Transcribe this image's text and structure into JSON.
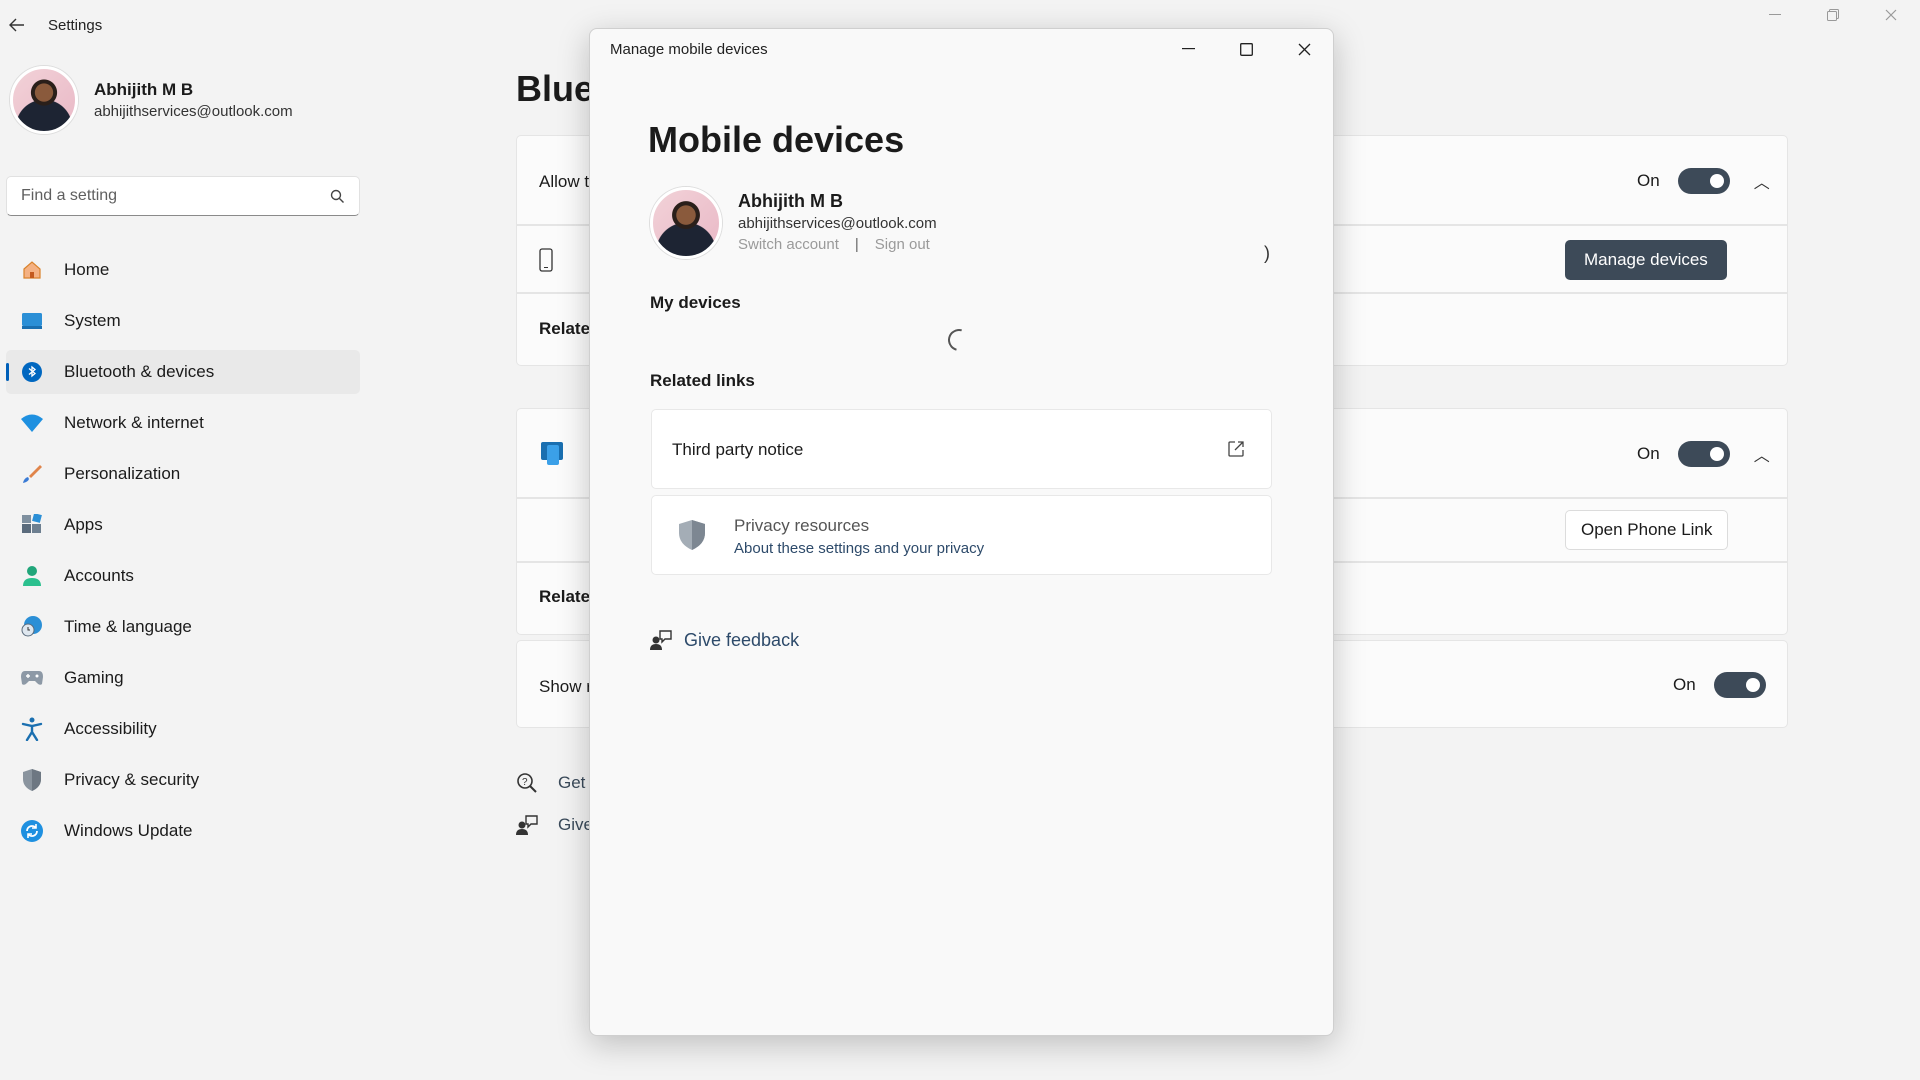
{
  "app": {
    "title": "Settings",
    "back_label": "←"
  },
  "profile": {
    "name": "Abhijith M B",
    "email": "abhijithservices@outlook.com"
  },
  "search": {
    "placeholder": "Find a setting"
  },
  "nav": {
    "items": [
      {
        "label": "Home",
        "icon": "home-icon"
      },
      {
        "label": "System",
        "icon": "system-icon"
      },
      {
        "label": "Bluetooth & devices",
        "icon": "bluetooth-icon",
        "active": true
      },
      {
        "label": "Network & internet",
        "icon": "wifi-icon"
      },
      {
        "label": "Personalization",
        "icon": "brush-icon"
      },
      {
        "label": "Apps",
        "icon": "apps-icon"
      },
      {
        "label": "Accounts",
        "icon": "accounts-icon"
      },
      {
        "label": "Time & language",
        "icon": "globe-clock-icon"
      },
      {
        "label": "Gaming",
        "icon": "gamepad-icon"
      },
      {
        "label": "Accessibility",
        "icon": "accessibility-icon"
      },
      {
        "label": "Privacy & security",
        "icon": "shield-icon"
      },
      {
        "label": "Windows Update",
        "icon": "update-icon"
      }
    ]
  },
  "content": {
    "title_fragment": "Blue",
    "card1": {
      "text": "Allow t",
      "toggle_label": "On",
      "toggle_on": true
    },
    "card2": {
      "button": "Manage devices"
    },
    "card3": {
      "text": "Relate"
    },
    "card4": {
      "toggle_label": "On",
      "toggle_on": true
    },
    "card5": {
      "button": "Open Phone Link"
    },
    "card6": {
      "text": "Relate"
    },
    "card7": {
      "text": "Show r",
      "toggle_label": "On",
      "toggle_on": true
    },
    "links": [
      {
        "label": "Get",
        "icon": "get-help-icon"
      },
      {
        "label": "Give",
        "icon": "feedback-icon"
      }
    ]
  },
  "dialog": {
    "title": "Manage mobile devices",
    "heading": "Mobile devices",
    "account": {
      "name": "Abhijith M B",
      "email": "abhijithservices@outlook.com",
      "switch_label": "Switch account",
      "separator": "|",
      "signout_label": "Sign out"
    },
    "my_devices_label": "My devices",
    "related_links_label": "Related links",
    "third_party_notice": "Third party notice",
    "privacy": {
      "title": "Privacy resources",
      "subtitle": "About these settings and your privacy"
    },
    "feedback_label": "Give feedback"
  },
  "colors": {
    "accent": "#005fb8",
    "toggle_on": "#3d4a58",
    "background": "#f3f3f3"
  }
}
